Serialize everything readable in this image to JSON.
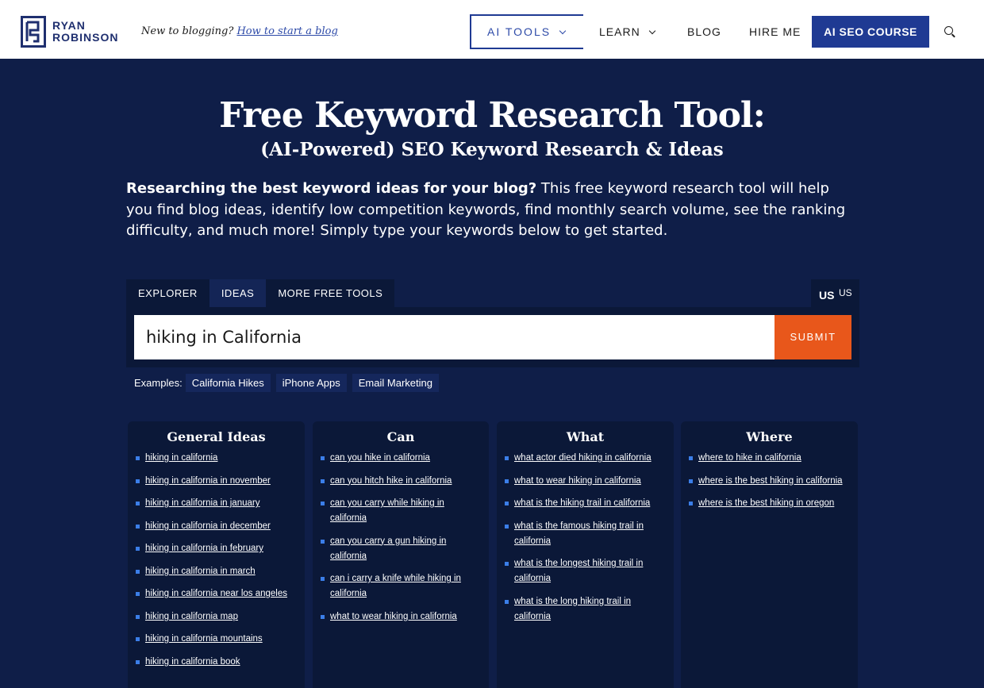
{
  "header": {
    "logo_line1": "RYAN",
    "logo_line2": "ROBINSON",
    "tagline_prefix": "New to blogging?",
    "tagline_link": "How to start a blog",
    "nav": {
      "ai_tools": "AI TOOLS",
      "learn": "LEARN",
      "blog": "BLOG",
      "hire_me": "HIRE ME",
      "cta": "AI SEO COURSE"
    },
    "colors": {
      "brand": "#1f3a93",
      "accent": "#e8571b",
      "background": "#0f1e48"
    }
  },
  "hero": {
    "title": "Free Keyword Research Tool:",
    "subtitle": "(AI-Powered) SEO Keyword Research & Ideas",
    "intro_bold": "Researching the best keyword ideas for your blog?",
    "intro_rest": " This free keyword research tool will help you find blog ideas, identify low competition keywords, find monthly search volume, see the ranking difficulty, and much more! Simply type your keywords below to get started."
  },
  "tool": {
    "tabs": [
      "EXPLORER",
      "IDEAS",
      "MORE FREE TOOLS"
    ],
    "active_tab": "IDEAS",
    "country_flag": "US",
    "country_code": "US",
    "search_value": "hiking in California",
    "submit_label": "SUBMIT",
    "examples_label": "Examples:",
    "examples": [
      "California Hikes",
      "iPhone Apps",
      "Email Marketing"
    ]
  },
  "results": [
    {
      "heading": "General Ideas",
      "items": [
        "hiking in california",
        "hiking in california in november",
        "hiking in california in january",
        "hiking in california in december",
        "hiking in california in february",
        "hiking in california in march",
        "hiking in california near los angeles",
        "hiking in california map",
        "hiking in california mountains",
        "hiking in california book"
      ]
    },
    {
      "heading": "Can",
      "items": [
        "can you hike in california",
        "can you hitch hike in california",
        "can you carry while hiking in california",
        "can you carry a gun hiking in california",
        "can i carry a knife while hiking in california",
        "what to wear hiking in california"
      ]
    },
    {
      "heading": "What",
      "items": [
        "what actor died hiking in california",
        "what to wear hiking in california",
        "what is the hiking trail in california",
        "what is the famous hiking trail in california",
        "what is the longest hiking trail in california",
        "what is the long hiking trail in california"
      ]
    },
    {
      "heading": "Where",
      "items": [
        "where to hike in california",
        "where is the best hiking in california",
        "where is the best hiking in oregon"
      ]
    }
  ]
}
